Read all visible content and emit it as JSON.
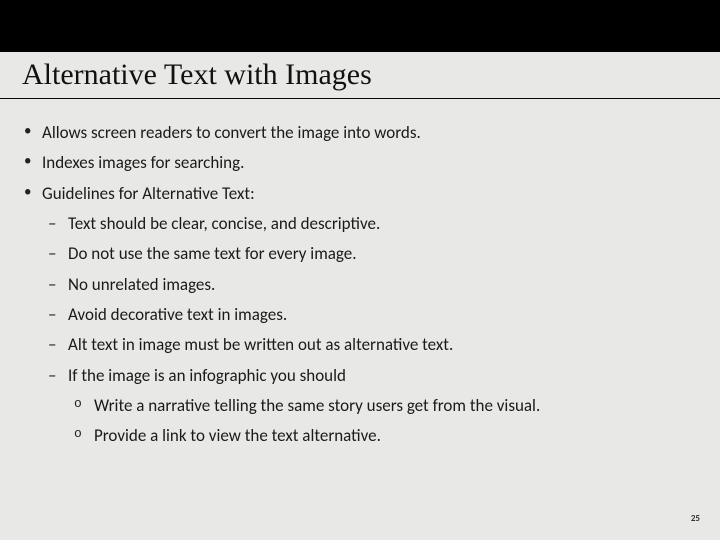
{
  "slide": {
    "title": "Alternative Text with Images",
    "bullets": {
      "b0": "Allows screen readers to convert the image into words.",
      "b1": "Indexes images for searching.",
      "b2": "Guidelines for Alternative Text:",
      "b2_sub": {
        "s0": "Text should be clear, concise, and descriptive.",
        "s1": "Do not use the same text for every image.",
        "s2": "No unrelated images.",
        "s3": "Avoid decorative text in images.",
        "s4": "Alt text in image must be written out as alternative text.",
        "s5": "If the image is an infographic you should",
        "s5_sub": {
          "t0": "Write a narrative telling the same story users get from the visual.",
          "t1": "Provide a link to view the text alternative."
        }
      }
    },
    "page_number": "25"
  }
}
